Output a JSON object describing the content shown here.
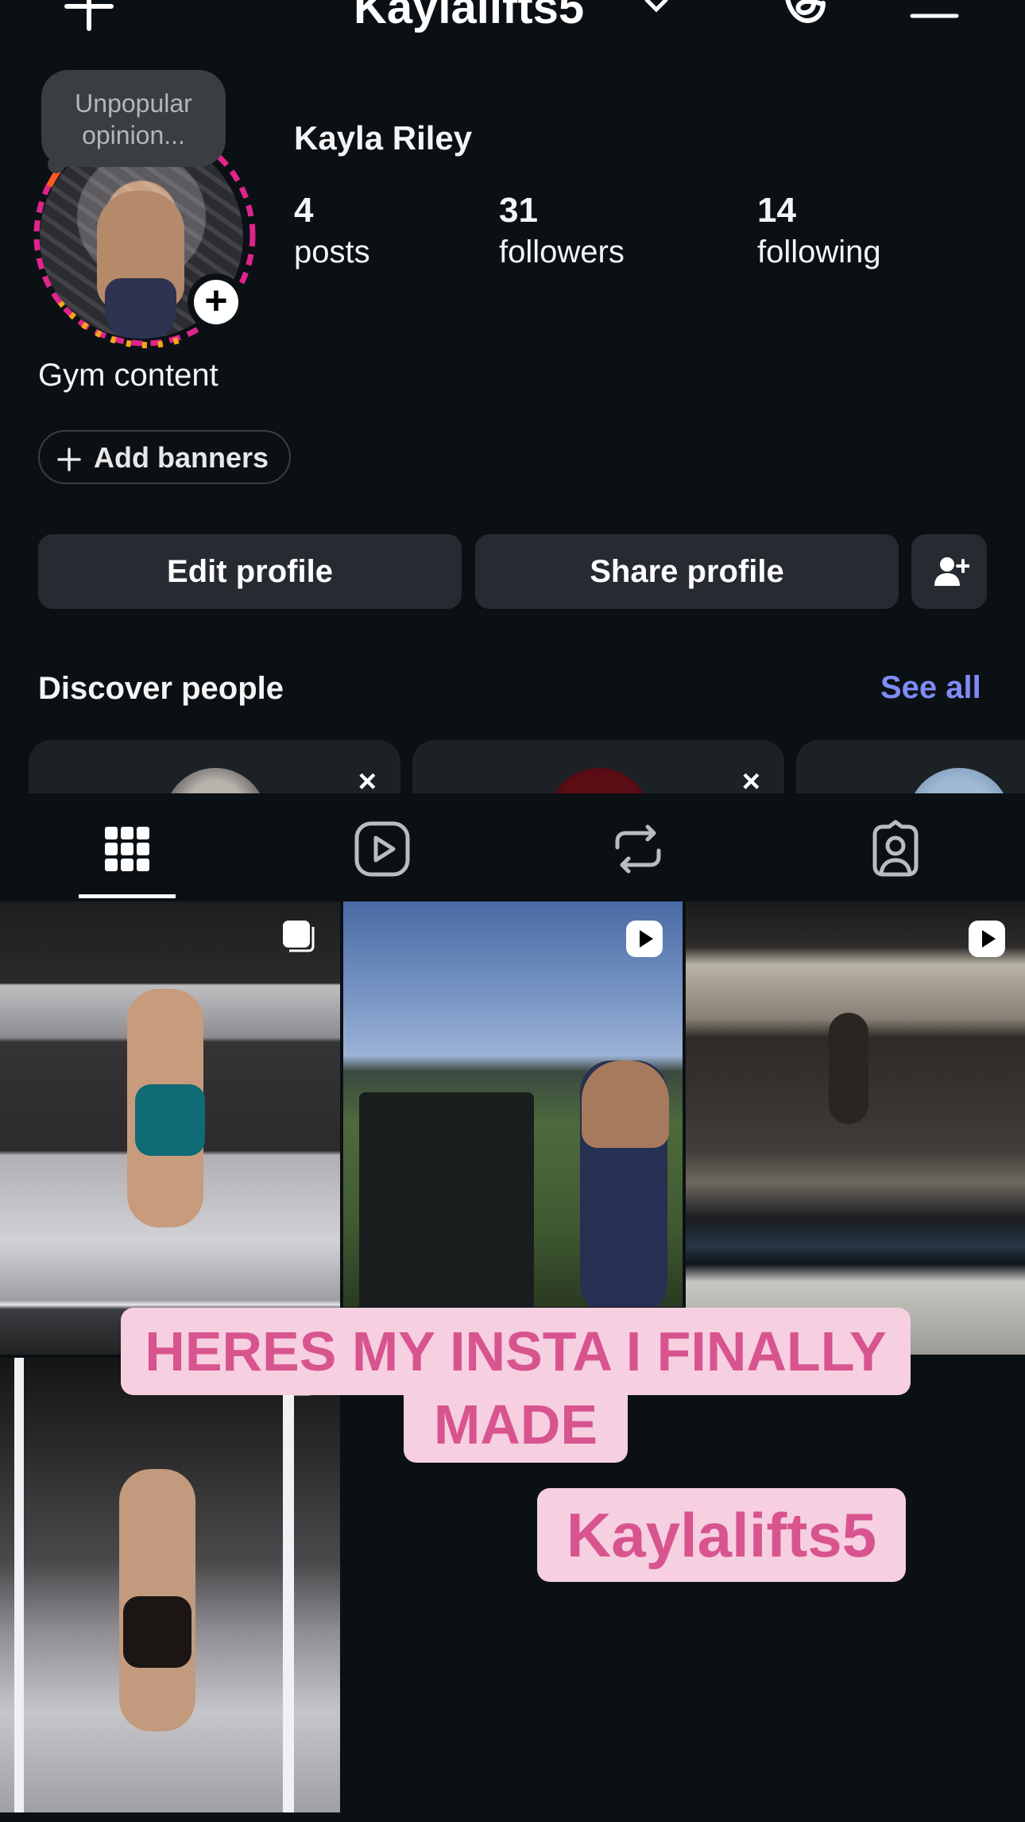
{
  "header": {
    "username": "Kaylalifts5",
    "icons": [
      "plus-icon",
      "chevron-down-icon",
      "threads-icon",
      "menu-icon"
    ]
  },
  "profile": {
    "note": "Unpopular opinion...",
    "full_name": "Kayla Riley",
    "stats": [
      {
        "value": "4",
        "label": "posts"
      },
      {
        "value": "31",
        "label": "followers"
      },
      {
        "value": "14",
        "label": "following"
      }
    ],
    "bio": "Gym content",
    "add_banners_label": "Add banners"
  },
  "actions": {
    "edit_profile": "Edit profile",
    "share_profile": "Share profile"
  },
  "discover": {
    "title": "Discover people",
    "see_all": "See all",
    "dismiss": "×"
  },
  "tabs": [
    "grid-icon",
    "reels-icon",
    "reposts-icon",
    "tagged-icon"
  ],
  "overlay": {
    "line1": "HERES MY INSTA I FINALLY",
    "line2": "MADE",
    "handle": "Kaylalifts5"
  },
  "colors": {
    "background": "#0b1014",
    "button": "#262b31",
    "link": "#7e8cf6",
    "overlay_bg": "#f6cfe0",
    "overlay_text": "#d8548e"
  }
}
